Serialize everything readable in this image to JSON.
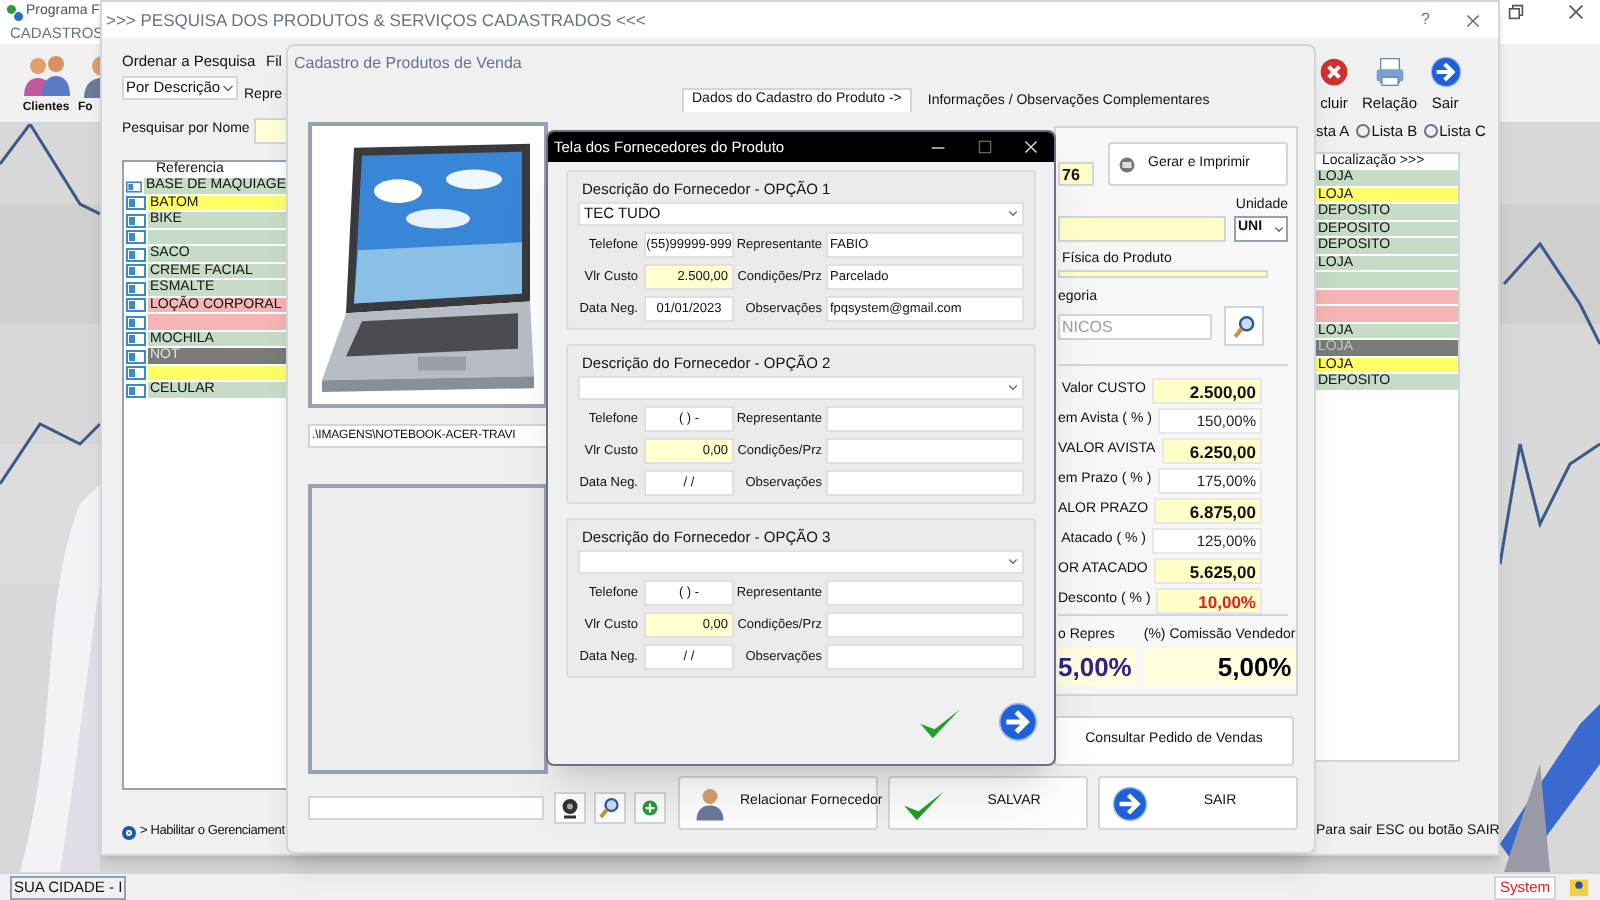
{
  "app": {
    "title": "Programa F",
    "menu": [
      "CADASTROS"
    ],
    "toolbar": [
      {
        "label": "Clientes",
        "kind": "people"
      },
      {
        "label": "Fo",
        "kind": "person"
      }
    ],
    "status_bar": {
      "city": "SUA CIDADE - I",
      "system": "System"
    }
  },
  "search_window": {
    "title": ">>> PESQUISA DOS PRODUTOS & SERVIÇOS CADASTRADOS <<<",
    "help": "?",
    "sort_label": "Ordenar a Pesquisa",
    "filter_label": "Fil",
    "sort_value": "Por Descrição",
    "rep_label": "Repre",
    "search_label": "Pesquisar por Nome",
    "reference_header": "Referencia",
    "location_header": "Localização >>>",
    "rows": [
      {
        "reference": "BASE DE MAQUIAGE",
        "location": "LOJA",
        "color": "#c6dcc6"
      },
      {
        "reference": "BATOM",
        "location": "LOJA",
        "color": "#ffff66"
      },
      {
        "reference": "BIKE",
        "location": "DEPOSITO",
        "color": "#c6dcc6"
      },
      {
        "location": "DEPOSITO",
        "color": "#c6dcc6"
      },
      {
        "reference": "SACO",
        "location": "DEPOSITO",
        "color": "#c6dcc6"
      },
      {
        "reference": "CREME FACIAL",
        "location": "LOJA",
        "color": "#c6dcc6"
      },
      {
        "reference": "ESMALTE",
        "color": "#c6dcc6"
      },
      {
        "reference": "LOÇÃO CORPORAL",
        "color": "#f5b5b5"
      },
      {
        "color": "#f5b5b5"
      },
      {
        "reference": "MOCHILA",
        "location": "LOJA",
        "color": "#c6dcc6"
      },
      {
        "reference": "NOT",
        "location": "LOJA",
        "color": "#7a7a7a"
      },
      {
        "location": "LOJA",
        "color": "#ffff66"
      },
      {
        "reference": "CELULAR",
        "location": "DEPOSITO",
        "color": "#c6dcc6"
      }
    ],
    "toolbar": [
      {
        "label": "cluir",
        "kind": "delete"
      },
      {
        "label": "Relação",
        "kind": "report"
      },
      {
        "label": "Sair",
        "kind": "exit"
      }
    ],
    "lists": [
      {
        "label": "sta A"
      },
      {
        "label": "Lista B",
        "selected": false
      },
      {
        "label": "Lista C",
        "selected": false
      }
    ],
    "manage_option": {
      "label": "> Habilitar o Gerenciament",
      "checked": true
    },
    "hint": "Para sair ESC ou botão SAIR"
  },
  "product_window": {
    "title": "Cadastro de Produtos de Venda",
    "tabs": [
      {
        "label": "Dados do Cadastro do Produto ->",
        "selected": true
      },
      {
        "label": "Informações / Observações Complementares",
        "selected": false
      }
    ],
    "image_path": ".\\IMAGENS\\NOTEBOOK-ACER-TRAVI",
    "code": "76",
    "print_button": "Gerar e Imprimir",
    "unit_label": "Unidade",
    "unit": "UNI",
    "location_label": "Física do Produto",
    "category_label": "egoria",
    "category": "NICOS",
    "pricing": [
      {
        "label": "Valor CUSTO",
        "value": "2.500,00",
        "kind": "money"
      },
      {
        "label": "em Avista ( % )",
        "value": "150,00%",
        "kind": "percent"
      },
      {
        "label": "VALOR AVISTA",
        "value": "6.250,00",
        "kind": "money"
      },
      {
        "label": "em Prazo ( % )",
        "value": "175,00%",
        "kind": "percent"
      },
      {
        "label": "ALOR PRAZO",
        "value": "6.875,00",
        "kind": "money"
      },
      {
        "label": "Atacado ( % )",
        "value": "125,00%",
        "kind": "percent"
      },
      {
        "label": "OR ATACADO",
        "value": "5.625,00",
        "kind": "money"
      },
      {
        "label": "Desconto ( % )",
        "value": "10,00%",
        "kind": "discount"
      }
    ],
    "commissions": [
      {
        "label": "o Repres",
        "value": "5,00%",
        "color": "#33228a"
      },
      {
        "label": "(%) Comissão Vendedor",
        "value": "5,00%",
        "color": "#000000"
      }
    ],
    "orders_button": "Consultar Pedido de Vendas",
    "buttons": [
      {
        "label": "Relacionar Fornecedor",
        "kind": "person"
      },
      {
        "label": "SALVAR",
        "kind": "check"
      },
      {
        "label": "SAIR",
        "kind": "exit"
      }
    ]
  },
  "supplier_dialog": {
    "title": "Tela dos Fornecedores do Produto",
    "groups": [
      {
        "title": "Descrição do Fornecedor - OPÇÃO 1",
        "supplier": "TEC TUDO",
        "fields": [
          {
            "label": "Telefone",
            "value": "(55)99999-999",
            "kind": "phone"
          },
          {
            "label": "Representante",
            "value": "FABIO",
            "kind": "text"
          },
          {
            "label": "Vlr Custo",
            "value": "2.500,00",
            "kind": "money"
          },
          {
            "label": "Condições/Prz",
            "value": "Parcelado",
            "kind": "text"
          },
          {
            "label": "Data Neg.",
            "value": "01/01/2023",
            "kind": "date"
          },
          {
            "label": "Observações",
            "value": "fpqsystem@gmail.com",
            "kind": "text"
          }
        ]
      },
      {
        "title": "Descrição do Fornecedor - OPÇÃO 2",
        "fields": [
          {
            "label": "Telefone",
            "value": "( ) -",
            "kind": "phone"
          },
          {
            "label": "Representante",
            "kind": "text"
          },
          {
            "label": "Vlr Custo",
            "value": "0,00",
            "kind": "money"
          },
          {
            "label": "Condições/Prz",
            "kind": "text"
          },
          {
            "label": "Data Neg.",
            "value": "/ /",
            "kind": "date"
          },
          {
            "label": "Observações",
            "kind": "text"
          }
        ]
      },
      {
        "title": "Descrição do Fornecedor - OPÇÃO 3",
        "fields": [
          {
            "label": "Telefone",
            "value": "( ) -",
            "kind": "phone"
          },
          {
            "label": "Representante",
            "kind": "text"
          },
          {
            "label": "Vlr Custo",
            "value": "0,00",
            "kind": "money"
          },
          {
            "label": "Condições/Prz",
            "kind": "text"
          },
          {
            "label": "Data Neg.",
            "value": "/ /",
            "kind": "date"
          },
          {
            "label": "Observações",
            "kind": "text"
          }
        ]
      }
    ]
  }
}
